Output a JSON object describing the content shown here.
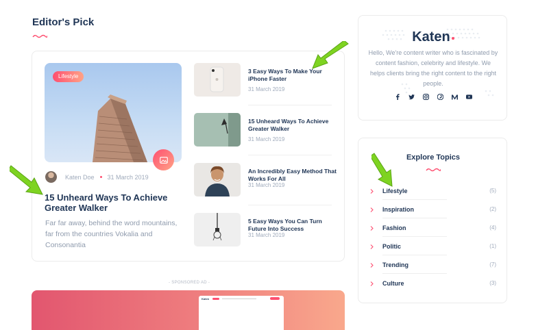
{
  "section": {
    "title": "Editor's Pick"
  },
  "featured": {
    "badge": "Lifestyle",
    "format_icon": "image-icon",
    "author": "Katen Doe",
    "date": "31 March 2019",
    "title": "15 Unheard Ways To Achieve Greater Walker",
    "excerpt": "Far far away, behind the word mountains, far from the countries Vokalia and Consonantia"
  },
  "posts": [
    {
      "title": "3 Easy Ways To Make Your iPhone Faster",
      "date": "31 March 2019"
    },
    {
      "title": "15 Unheard Ways To Achieve Greater Walker",
      "date": "31 March 2019"
    },
    {
      "title": "An Incredibly Easy Method That Works For All",
      "date": "31 March 2019"
    },
    {
      "title": "5 Easy Ways You Can Turn Future Into Success",
      "date": "31 March 2019"
    }
  ],
  "ad": {
    "label": "- SPONSORED AD -",
    "mock_brand": "Katen"
  },
  "about": {
    "logo": "Katen",
    "text": "Hello, We're content writer who is fascinated by content fashion, celebrity and lifestyle. We helps clients bring the right content to the right people.",
    "socials": [
      "facebook-icon",
      "twitter-icon",
      "instagram-icon",
      "pinterest-icon",
      "medium-icon",
      "youtube-icon"
    ]
  },
  "topics": {
    "title": "Explore Topics",
    "items": [
      {
        "name": "Lifestyle",
        "count": "(5)"
      },
      {
        "name": "Inspiration",
        "count": "(2)"
      },
      {
        "name": "Fashion",
        "count": "(4)"
      },
      {
        "name": "Politic",
        "count": "(1)"
      },
      {
        "name": "Trending",
        "count": "(7)"
      },
      {
        "name": "Culture",
        "count": "(3)"
      }
    ]
  },
  "colors": {
    "accent": "#fe4f70",
    "accent2": "#ffa387",
    "heading": "#203656",
    "muted": "#9faabb",
    "arrow": "#7ed321"
  }
}
